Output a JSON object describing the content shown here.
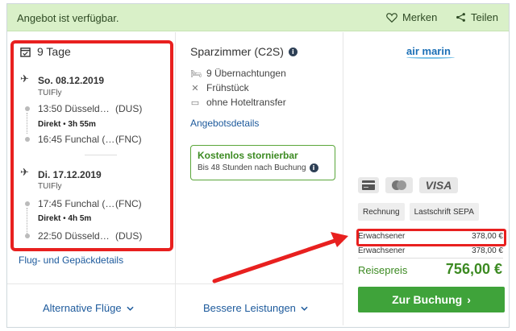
{
  "banner": {
    "title": "Angebot ist verfügbar.",
    "merken": "Merken",
    "teilen": "Teilen"
  },
  "flight": {
    "duration": "9 Tage",
    "outbound": {
      "date": "So. 08.12.2019",
      "airline": "TUIFly",
      "dep_time_city": "13:50 Düsseld…",
      "dep_code": "(DUS)",
      "direct": "Direkt",
      "flight_time": "3h 55m",
      "arr_time_city": "16:45 Funchal (…",
      "arr_code": "(FNC)"
    },
    "return": {
      "date": "Di. 17.12.2019",
      "airline": "TUIFly",
      "dep_time_city": "17:45 Funchal (…",
      "dep_code": "(FNC)",
      "direct": "Direkt",
      "flight_time": "4h 5m",
      "arr_time_city": "22:50 Düsseld…",
      "arr_code": "(DUS)"
    },
    "details_link": "Flug- und Gepäckdetails"
  },
  "room": {
    "title": "Sparzimmer (C2S)",
    "features": [
      "9 Übernachtungen",
      "Frühstück",
      "ohne Hoteltransfer"
    ],
    "details_link": "Angebotsdetails",
    "storno_title": "Kostenlos stornierbar",
    "storno_sub": "Bis 48 Stunden nach Buchung"
  },
  "operator": {
    "logo_text": "air marin"
  },
  "payment": {
    "cards": [
      "Mastercard",
      "VISA"
    ],
    "methods": [
      "Rechnung",
      "Lastschrift SEPA"
    ]
  },
  "price": {
    "rows": [
      {
        "label": "Erwachsener",
        "value": "378,00 €"
      },
      {
        "label": "Erwachsener",
        "value": "378,00 €"
      }
    ],
    "total_label": "Reisepreis",
    "total_value": "756,00 €",
    "book_button": "Zur Buchung"
  },
  "footer": {
    "alt_flights": "Alternative Flüge",
    "better": "Bessere Leistungen"
  },
  "colors": {
    "banner_bg": "#d9f0c8",
    "green": "#3fa33a",
    "link": "#1d5a9c",
    "highlight": "#e8201f"
  }
}
